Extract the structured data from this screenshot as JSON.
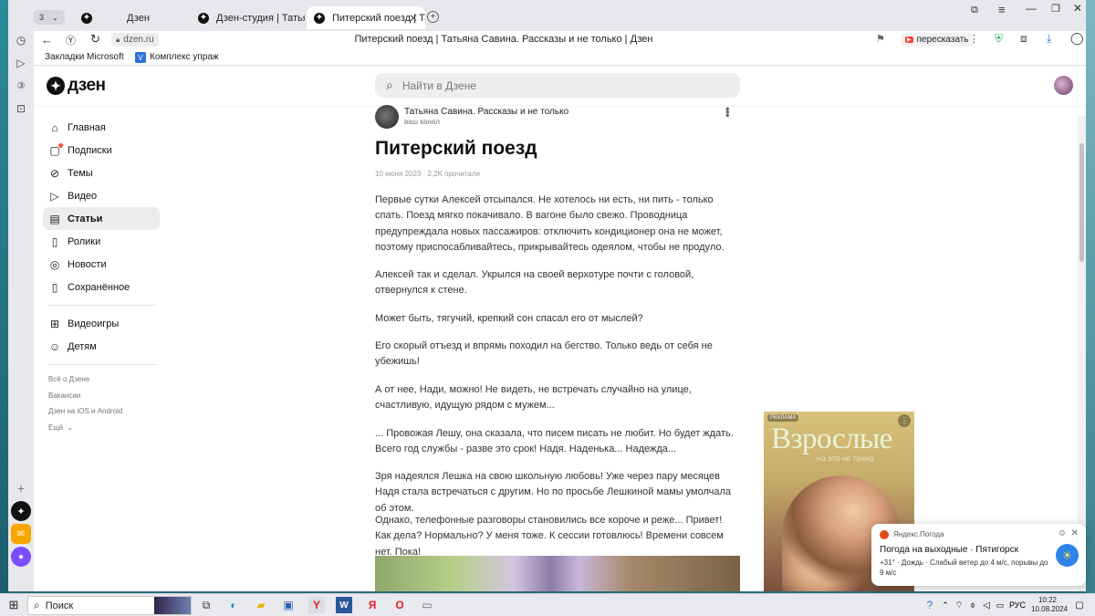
{
  "browser": {
    "tab_count": "3",
    "tabs": [
      {
        "label": "Дзен"
      },
      {
        "label": "Дзен-студия | Татьяна Са"
      },
      {
        "label": "Питерский поезд | Тат"
      }
    ],
    "address_domain": "dzen.ru",
    "page_title": "Питерский поезд | Татьяна Савина. Рассказы и не только | Дзен",
    "retell_label": "пересказать",
    "bookmarks": [
      {
        "label": "Закладки Microsoft"
      },
      {
        "label": "Комплекс упраж"
      }
    ]
  },
  "header": {
    "logo_text": "дзен",
    "search_placeholder": "Найти в Дзене"
  },
  "nav": {
    "items": [
      {
        "label": "Главная",
        "icon": "home-icon"
      },
      {
        "label": "Подписки",
        "icon": "subscriptions-icon"
      },
      {
        "label": "Темы",
        "icon": "topics-icon"
      },
      {
        "label": "Видео",
        "icon": "video-icon"
      },
      {
        "label": "Статьи",
        "icon": "articles-icon"
      },
      {
        "label": "Ролики",
        "icon": "shorts-icon"
      },
      {
        "label": "Новости",
        "icon": "news-icon"
      },
      {
        "label": "Сохранённое",
        "icon": "bookmark-icon"
      }
    ],
    "extra": [
      {
        "label": "Видеоигры",
        "icon": "gamepad-icon"
      },
      {
        "label": "Детям",
        "icon": "kids-icon"
      }
    ],
    "footer_links": [
      "Всё о Дзене",
      "Вакансии",
      "Дзен на iOS и Android",
      "Ещё"
    ]
  },
  "article": {
    "channel_name": "Татьяна Савина. Рассказы и не только",
    "channel_sub": "ваш канал",
    "title": "Питерский поезд",
    "meta": "10 июня 2023 · 2,2K прочитали",
    "paragraphs": [
      "Первые сутки Алексей отсыпался. Не хотелось ни есть, ни пить - только спать. Поезд мягко покачивало. В вагоне было свежо. Проводница предупреждала новых пассажиров: отключить кондиционер она не может, поэтому приспосабливайтесь, прикрывайтесь одеялом, чтобы не продуло.",
      "Алексей так и сделал. Укрылся на своей верхотуре почти с головой, отвернулся к стене.",
      "Может быть, тягучий, крепкий сон спасал его от мыслей?",
      "Его скорый отъезд и впрямь походил на бегство. Только ведь от себя не убежишь!",
      "А от нее, Нади, можно! Не видеть, не встречать случайно на улице, счастливую, идущую рядом с мужем...",
      "... Провожая Лешу, она сказала, что писем писать не любит. Но будет ждать. Всего год службы - разве это срок! Надя. Наденька... Надежда...",
      "Зря надеялся Лешка на свою школьную любовь! Уже через пару месяцев Надя стала встречаться с другим. Но по просьбе Лешкиной мамы умолчала об этом.",
      "Однако, телефонные разговоры становились все короче и реже... Привет! Как дела? Нормально? У меня тоже. К сессии готовлюсь! Времени совсем нет. Пока!"
    ]
  },
  "ad": {
    "tag": "РЕКЛАМА",
    "title": "Взрослые",
    "subtitle": "НО ЭТО НЕ ТОЧНО"
  },
  "notification": {
    "source": "Яндекс.Погода",
    "title": "Погода на выходные · Пятигорск",
    "body": "+31° · Дождь · Слабый ветер до 4 м/с, порывы до 9 м/с"
  },
  "taskbar": {
    "search_label": "Поиск",
    "lang": "РУС",
    "time": "10:22",
    "date": "10.08.2024"
  }
}
